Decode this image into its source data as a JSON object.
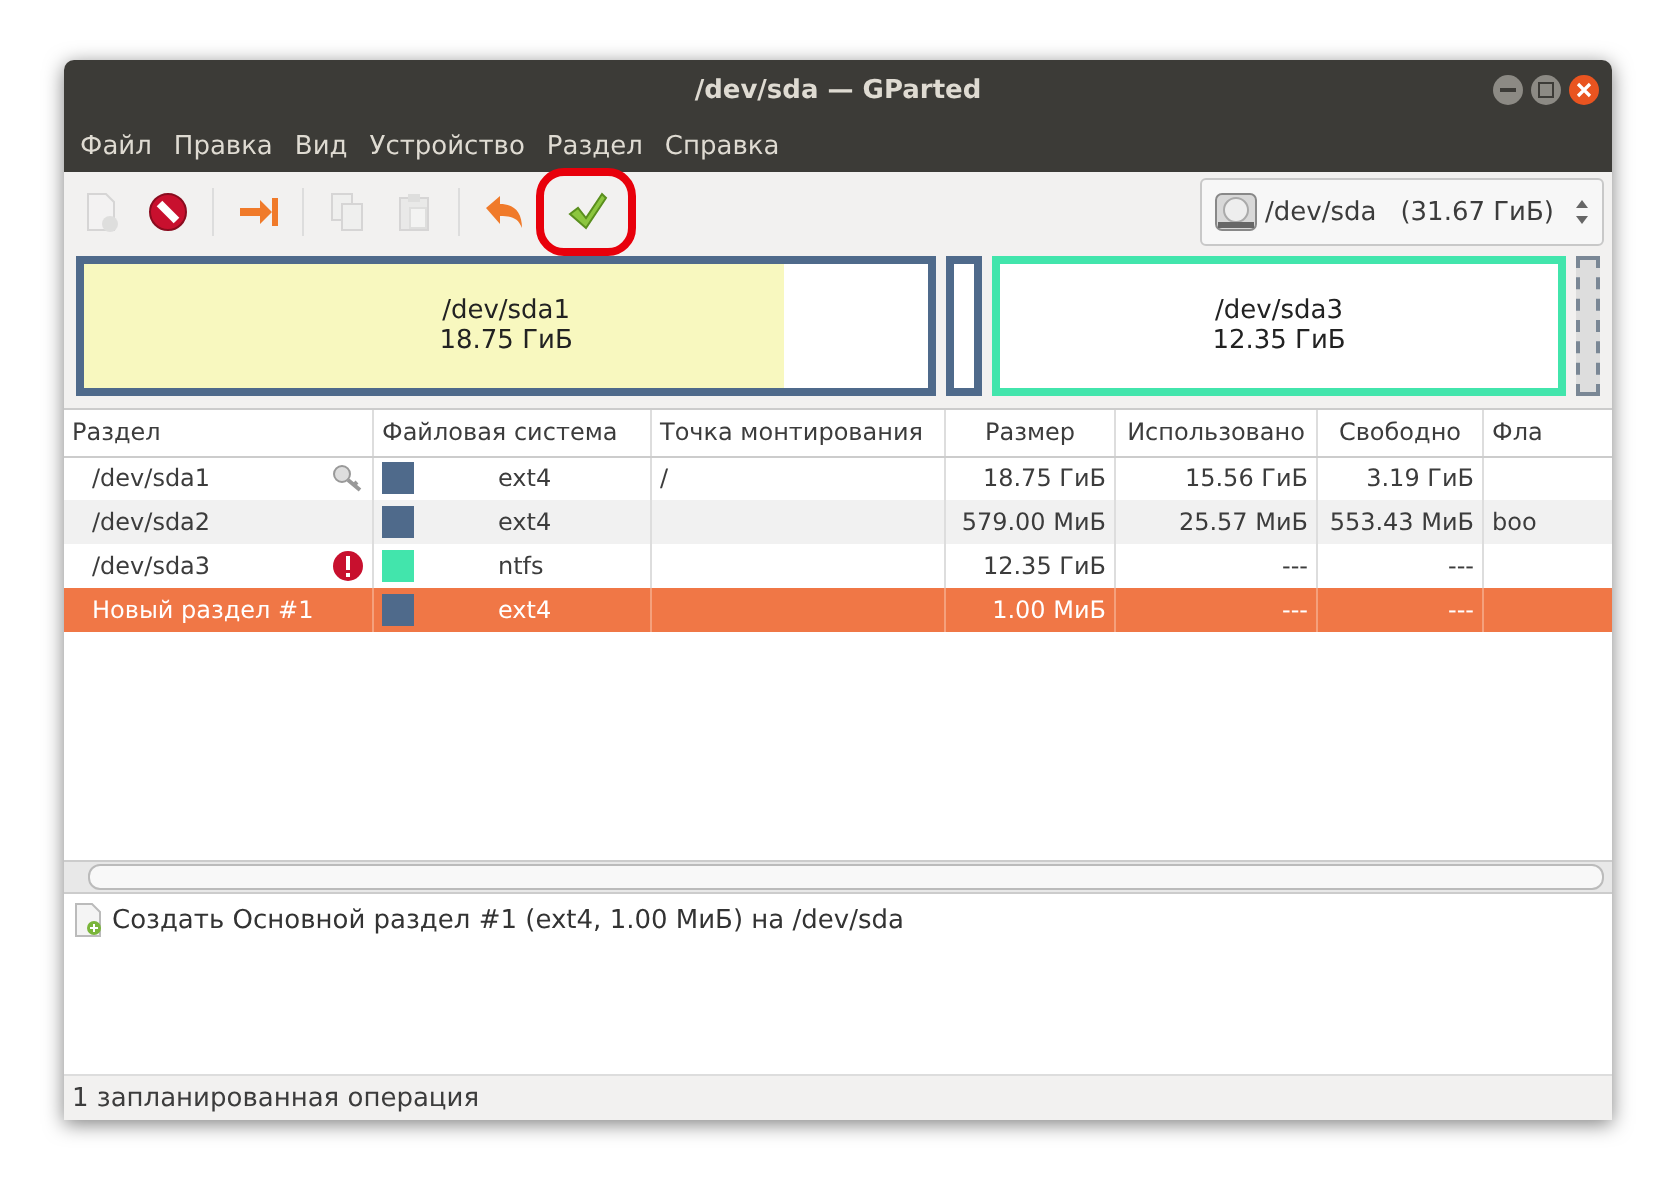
{
  "window": {
    "title": "/dev/sda — GParted"
  },
  "menu": [
    "Файл",
    "Правка",
    "Вид",
    "Устройство",
    "Раздел",
    "Справка"
  ],
  "toolbar": [
    {
      "kind": "new",
      "disabled": true,
      "highlighted": false
    },
    {
      "kind": "delete",
      "disabled": false,
      "highlighted": false
    },
    {
      "kind": "separator"
    },
    {
      "kind": "resize",
      "disabled": false,
      "highlighted": false
    },
    {
      "kind": "separator"
    },
    {
      "kind": "copy",
      "disabled": true,
      "highlighted": false
    },
    {
      "kind": "paste",
      "disabled": true,
      "highlighted": false
    },
    {
      "kind": "separator"
    },
    {
      "kind": "undo",
      "disabled": false,
      "highlighted": false
    },
    {
      "kind": "apply",
      "disabled": false,
      "highlighted": true
    }
  ],
  "device_selector": {
    "device": "/dev/sda",
    "size": "(31.67 ГиБ)"
  },
  "disk_map": [
    {
      "kind": "partition",
      "name": "/dev/sda1",
      "size": "18.75 ГиБ",
      "color": "#4f6a8b",
      "level": 0.83
    },
    {
      "kind": "partition",
      "color": "#4f6a8b"
    },
    {
      "kind": "partition",
      "name": "/dev/sda3",
      "size": "12.35 ГиБ",
      "color": "#42e5ac",
      "level": 0
    },
    {
      "kind": "unallocated"
    }
  ],
  "table": {
    "columns": [
      "Раздел",
      "Файловая система",
      "Точка монтирования",
      "Размер",
      "Использовано",
      "Свободно",
      "Фла"
    ],
    "rows": [
      {
        "partition": "/dev/sda1",
        "kind": "mounted",
        "color": "#4f6a8b",
        "filesystem": "ext4",
        "mount": "/",
        "size": "18.75 ГиБ",
        "used": "15.56 ГиБ",
        "free": "3.19 ГиБ",
        "flags": "",
        "selected": false
      },
      {
        "partition": "/dev/sda2",
        "kind": "plain",
        "color": "#4f6a8b",
        "filesystem": "ext4",
        "mount": "",
        "size": "579.00 МиБ",
        "used": "25.57 МиБ",
        "free": "553.43 МиБ",
        "flags": "boo",
        "selected": false
      },
      {
        "partition": "/dev/sda3",
        "kind": "error",
        "color": "#42e5ac",
        "filesystem": "ntfs",
        "mount": "",
        "size": "12.35 ГиБ",
        "used": "---",
        "free": "---",
        "flags": "",
        "selected": false
      },
      {
        "partition": "Новый раздел #1",
        "kind": "plain",
        "color": "#4f6a8b",
        "filesystem": "ext4",
        "mount": "",
        "size": "1.00 МиБ",
        "used": "---",
        "free": "---",
        "flags": "",
        "selected": true
      }
    ]
  },
  "operations": [
    "Создать Основной раздел #1 (ext4, 1.00 МиБ) на /dev/sda"
  ],
  "status_bar": "1 запланированная операция"
}
